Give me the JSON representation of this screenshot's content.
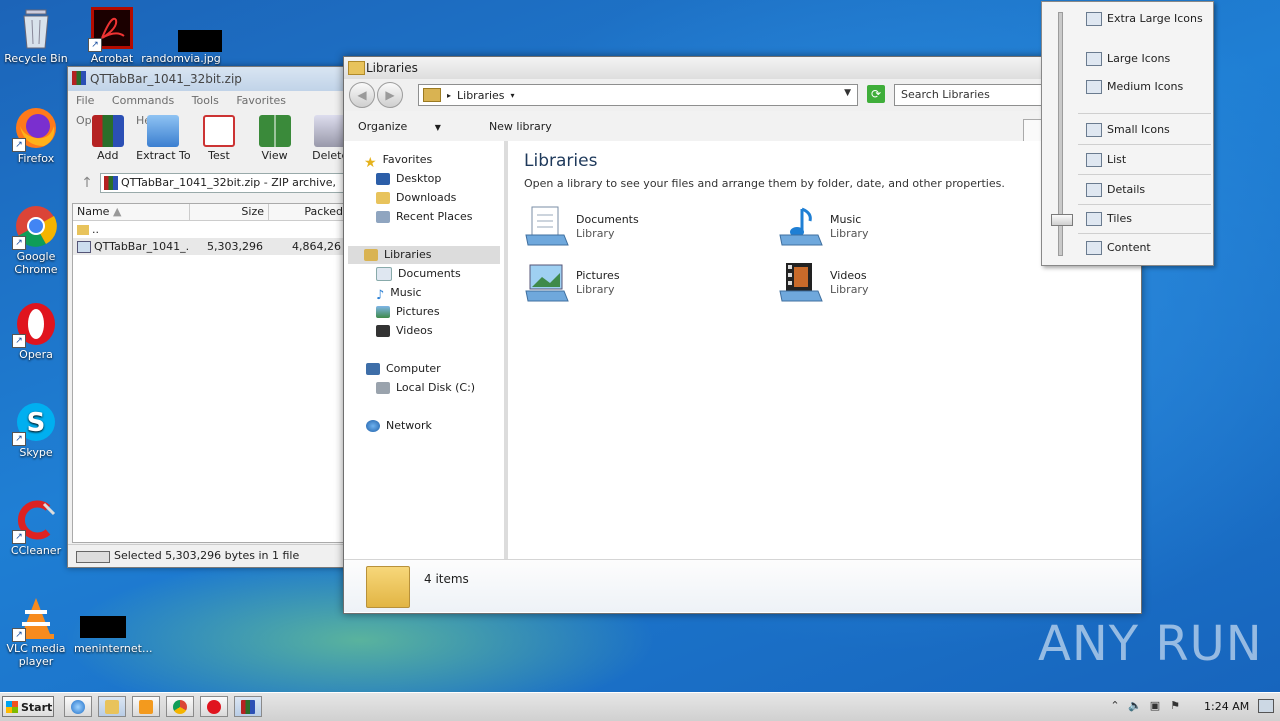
{
  "desktop": {
    "icons": [
      {
        "label": "Recycle Bin"
      },
      {
        "label": "Acrobat"
      },
      {
        "label": "randomvia.jpg"
      },
      {
        "label": "Firefox"
      },
      {
        "label": "Google Chrome"
      },
      {
        "label": "Opera"
      },
      {
        "label": "Skype"
      },
      {
        "label": "CCleaner"
      },
      {
        "label": "VLC media player"
      },
      {
        "label": "meninternet..."
      }
    ],
    "watermark": "ANY RUN"
  },
  "winrar": {
    "title": "QTTabBar_1041_32bit.zip",
    "menu": [
      "File",
      "Commands",
      "Tools",
      "Favorites",
      "Options",
      "Help"
    ],
    "tools": [
      "Add",
      "Extract To",
      "Test",
      "View",
      "Delete"
    ],
    "path": "QTTabBar_1041_32bit.zip - ZIP archive,",
    "columns": [
      "Name",
      "Size",
      "Packed"
    ],
    "rows": [
      {
        "name": "..",
        "size": "",
        "packed": ""
      },
      {
        "name": "QTTabBar_1041_...",
        "size": "5,303,296",
        "packed": "4,864,26"
      }
    ],
    "status": "Selected 5,303,296 bytes in 1 file"
  },
  "explorer": {
    "title": "Libraries",
    "address": "Libraries",
    "search_placeholder": "Search Libraries",
    "commands": [
      "Organize",
      "New library"
    ],
    "nav": {
      "favorites": "Favorites",
      "desktop": "Desktop",
      "downloads": "Downloads",
      "recent": "Recent Places",
      "libraries": "Libraries",
      "documents": "Documents",
      "music": "Music",
      "pictures": "Pictures",
      "videos": "Videos",
      "computer": "Computer",
      "local_disk": "Local Disk (C:)",
      "network": "Network"
    },
    "heading": "Libraries",
    "description": "Open a library to see your files and arrange them by folder, date, and other properties.",
    "tiles": [
      {
        "name": "Documents",
        "sub": "Library"
      },
      {
        "name": "Music",
        "sub": "Library"
      },
      {
        "name": "Pictures",
        "sub": "Library"
      },
      {
        "name": "Videos",
        "sub": "Library"
      }
    ],
    "item_count": "4 items"
  },
  "view_menu": {
    "items": [
      "Extra Large Icons",
      "Large Icons",
      "Medium Icons",
      "Small Icons",
      "List",
      "Details",
      "Tiles",
      "Content"
    ],
    "selected": "Tiles"
  },
  "taskbar": {
    "start": "Start",
    "clock": "1:24 AM"
  },
  "colors": {
    "desktop": "#1a6fc0",
    "title_heading": "#1e395b",
    "nav_selected": "#dcdcdc"
  }
}
